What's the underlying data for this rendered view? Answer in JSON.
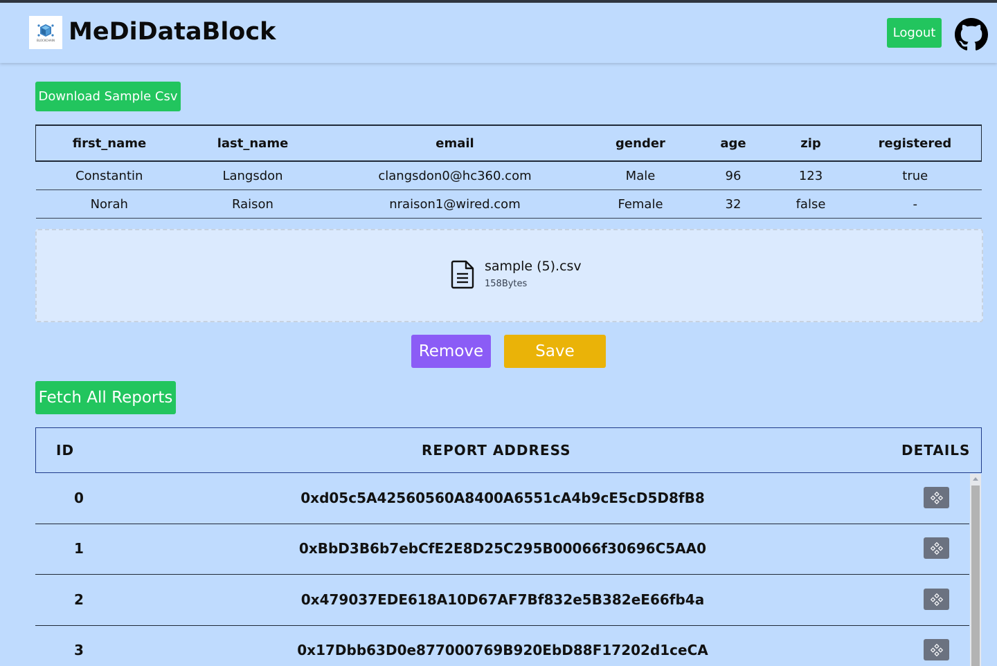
{
  "header": {
    "brand": "MeDiDataBlock",
    "logo_caption": "BLOCKCHAIN",
    "logout_label": "Logout",
    "github_icon": "github-icon"
  },
  "actions": {
    "download_label": "Download Sample Csv",
    "remove_label": "Remove",
    "save_label": "Save",
    "fetch_label": "Fetch All Reports"
  },
  "csv_table": {
    "headers": [
      "first_name",
      "last_name",
      "email",
      "gender",
      "age",
      "zip",
      "registered"
    ],
    "rows": [
      [
        "Constantin",
        "Langsdon",
        "clangsdon0@hc360.com",
        "Male",
        "96",
        "123",
        "true"
      ],
      [
        "Norah",
        "Raison",
        "nraison1@wired.com",
        "Female",
        "32",
        "false",
        "-"
      ]
    ]
  },
  "upload": {
    "file_name": "sample (5).csv",
    "file_size": "158Bytes",
    "icon": "file-text-icon"
  },
  "reports": {
    "headers": {
      "id": "ID",
      "address": "REPORT ADDRESS",
      "details": "DETAILS"
    },
    "rows": [
      {
        "id": "0",
        "address": "0xd05c5A42560560A8400A6551cA4b9cE5cD5D8fB8"
      },
      {
        "id": "1",
        "address": "0xBbD3B6b7ebCfE2E8D25C295B00066f30696C5AA0"
      },
      {
        "id": "2",
        "address": "0x479037EDE618A10D67AF7Bf832e5B382eE66fb4a"
      },
      {
        "id": "3",
        "address": "0x17Dbb63D0e877000769B920EbD88F17202d1ceCA"
      }
    ]
  },
  "colors": {
    "background": "#bfdbfe",
    "green": "#22c55e",
    "purple": "#8b5cf6",
    "yellow": "#eab308",
    "gray_button": "#6b7280"
  }
}
